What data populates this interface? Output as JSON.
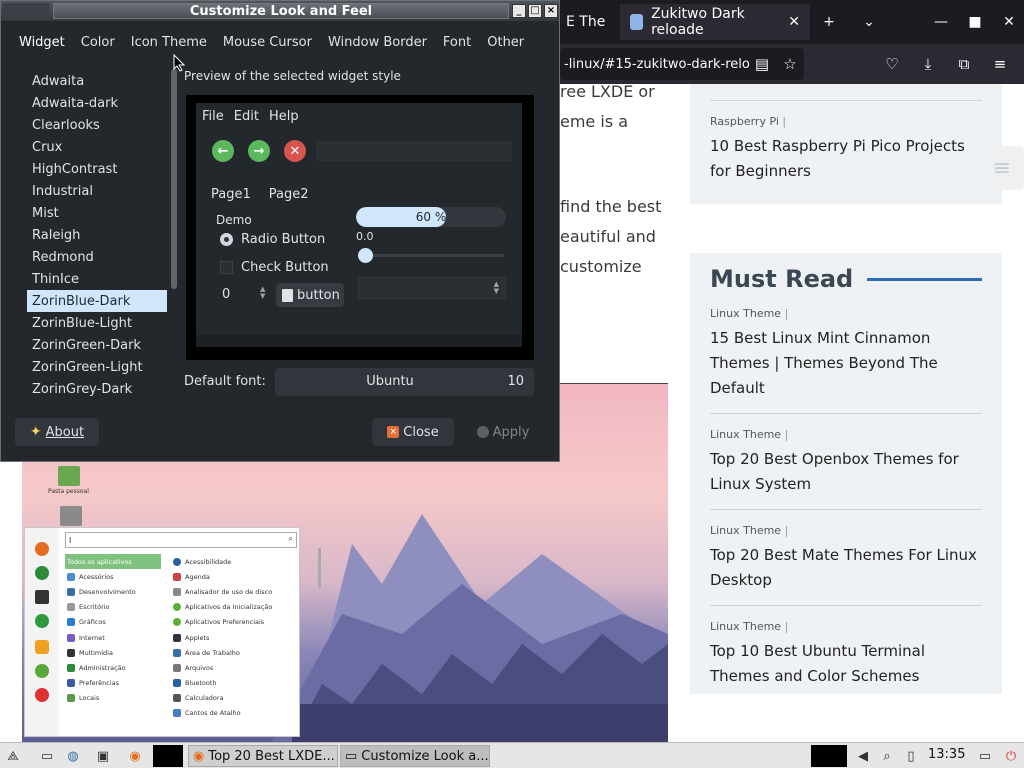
{
  "browser": {
    "tabs": [
      {
        "title": "E The"
      },
      {
        "title": "Zukitwo Dark reloade"
      }
    ],
    "new_tab_symbol": "+",
    "url": "-linux/#15-zukitwo-dark-relo",
    "content_lines": [
      "ree LXDE or",
      "eme is a",
      " find the best",
      "eautiful and",
      " customize"
    ],
    "sidebar_top": {
      "category": "Raspberry Pi",
      "title": "10 Best Raspberry Pi Pico Projects for Beginners"
    },
    "must_read": {
      "heading": "Must Read",
      "posts": [
        {
          "category": "Linux Theme",
          "title": "15 Best Linux Mint Cinnamon Themes | Themes Beyond The Default"
        },
        {
          "category": "Linux Theme",
          "title": "Top 20 Best Openbox Themes for Linux System"
        },
        {
          "category": "Linux Theme",
          "title": "Top 20 Best Mate Themes For Linux Desktop"
        },
        {
          "category": "Linux Theme",
          "title": "Top 10 Best Ubuntu Terminal Themes and Color Schemes"
        }
      ]
    }
  },
  "desktop": {
    "icon_label": "Pasta pessoal",
    "app_menu": {
      "search_text": "I",
      "categories": [
        "Todos os aplicativos",
        "Acessórios",
        "Desenvolvimento",
        "Escritório",
        "Gráficos",
        "Internet",
        "Multimídia",
        "Administração",
        "Preferências",
        "Locais"
      ],
      "apps": [
        "Acessibilidade",
        "Agenda",
        "Analisador de uso de disco",
        "Aplicativos da Inicialização",
        "Aplicativos Preferenciais",
        "Applets",
        "Área de Trabalho",
        "Arquivos",
        "Bluetooth",
        "Calculadora",
        "Cantos de Atalho"
      ]
    }
  },
  "dialog": {
    "title": "Customize Look and Feel",
    "tabs": [
      "Widget",
      "Color",
      "Icon Theme",
      "Mouse Cursor",
      "Window Border",
      "Font",
      "Other"
    ],
    "themes": [
      "Adwaita",
      "Adwaita-dark",
      "Clearlooks",
      "Crux",
      "HighContrast",
      "Industrial",
      "Mist",
      "Raleigh",
      "Redmond",
      "ThinIce",
      "ZorinBlue-Dark",
      "ZorinBlue-Light",
      "ZorinGreen-Dark",
      "ZorinGreen-Light",
      "ZorinGrey-Dark"
    ],
    "selected_theme": "ZorinBlue-Dark",
    "preview": {
      "label": "Preview of the selected widget style",
      "menu": [
        "File",
        "Edit",
        "Help"
      ],
      "pages": [
        "Page1",
        "Page2"
      ],
      "demo_label": "Demo",
      "radio_label": "Radio Button",
      "check_label": "Check Button",
      "progress_text": "60 %",
      "progress_value": 0.6,
      "scale_value": "0.0",
      "spin_value": "0",
      "button_label": "button"
    },
    "default_font_label": "Default font:",
    "font_name": "Ubuntu",
    "font_size": "10",
    "about_label": "About",
    "close_label": "Close",
    "apply_label": "Apply"
  },
  "taskbar": {
    "tasks": [
      "Top 20 Best LXDE...",
      "Customize Look a..."
    ],
    "clock": "13:35"
  },
  "colors": {
    "dialog_bg": "#24282d",
    "selection": "#cfe6fb",
    "browser_dark": "#1c1b22",
    "accent_blue": "#2e6db4"
  }
}
